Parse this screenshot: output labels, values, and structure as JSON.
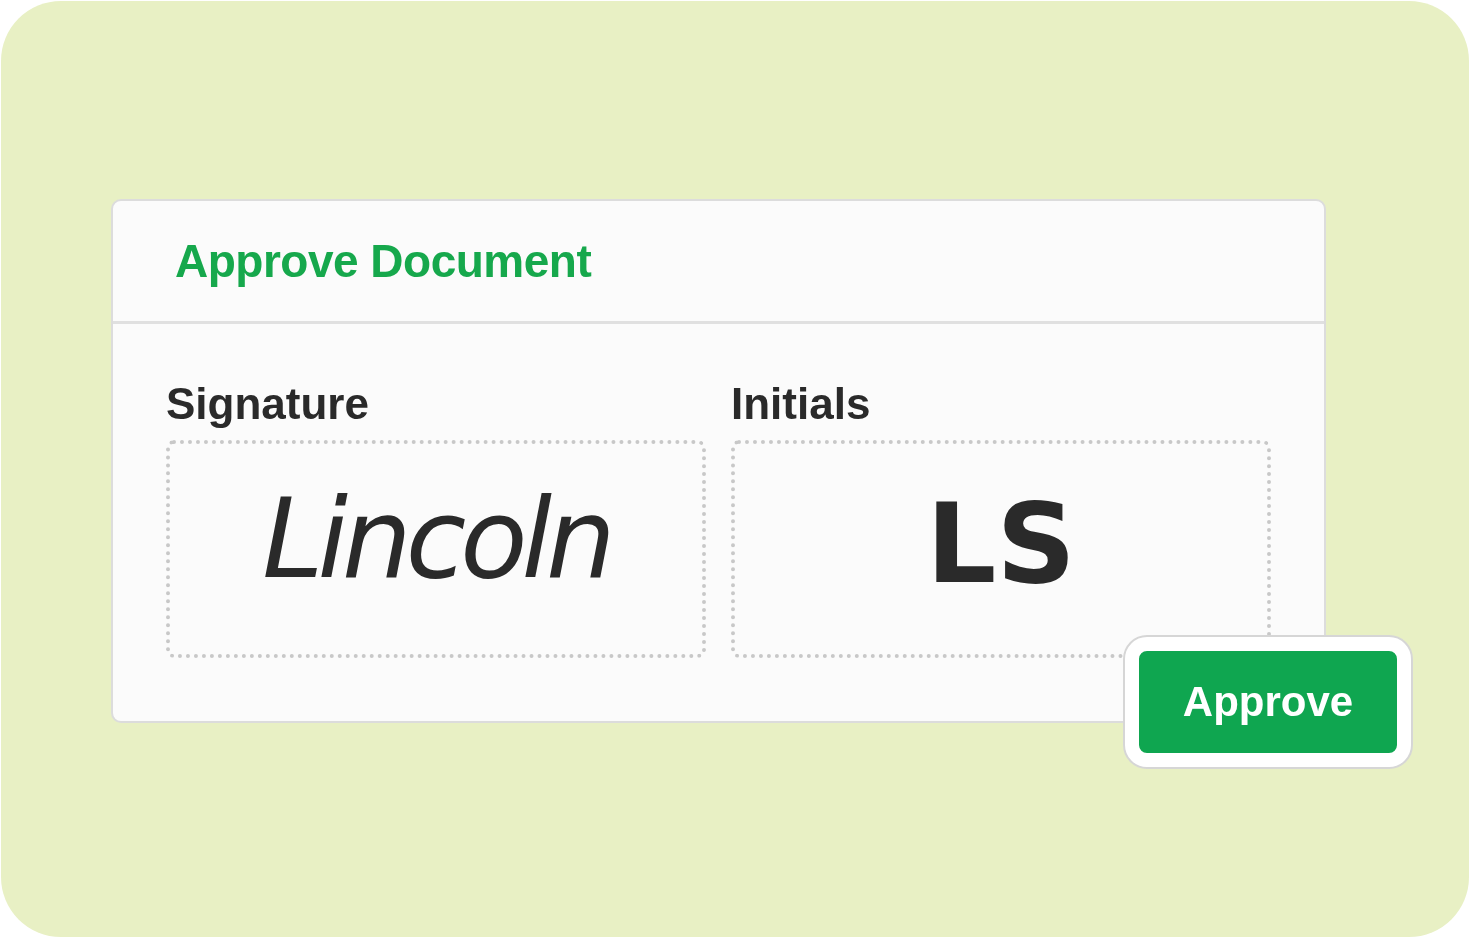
{
  "dialog": {
    "title": "Approve Document"
  },
  "fields": [
    {
      "label": "Signature",
      "value": "Lincoln"
    },
    {
      "label": "Initials",
      "value": "LS"
    }
  ],
  "buttons": [
    {
      "label": "Approve"
    }
  ]
}
